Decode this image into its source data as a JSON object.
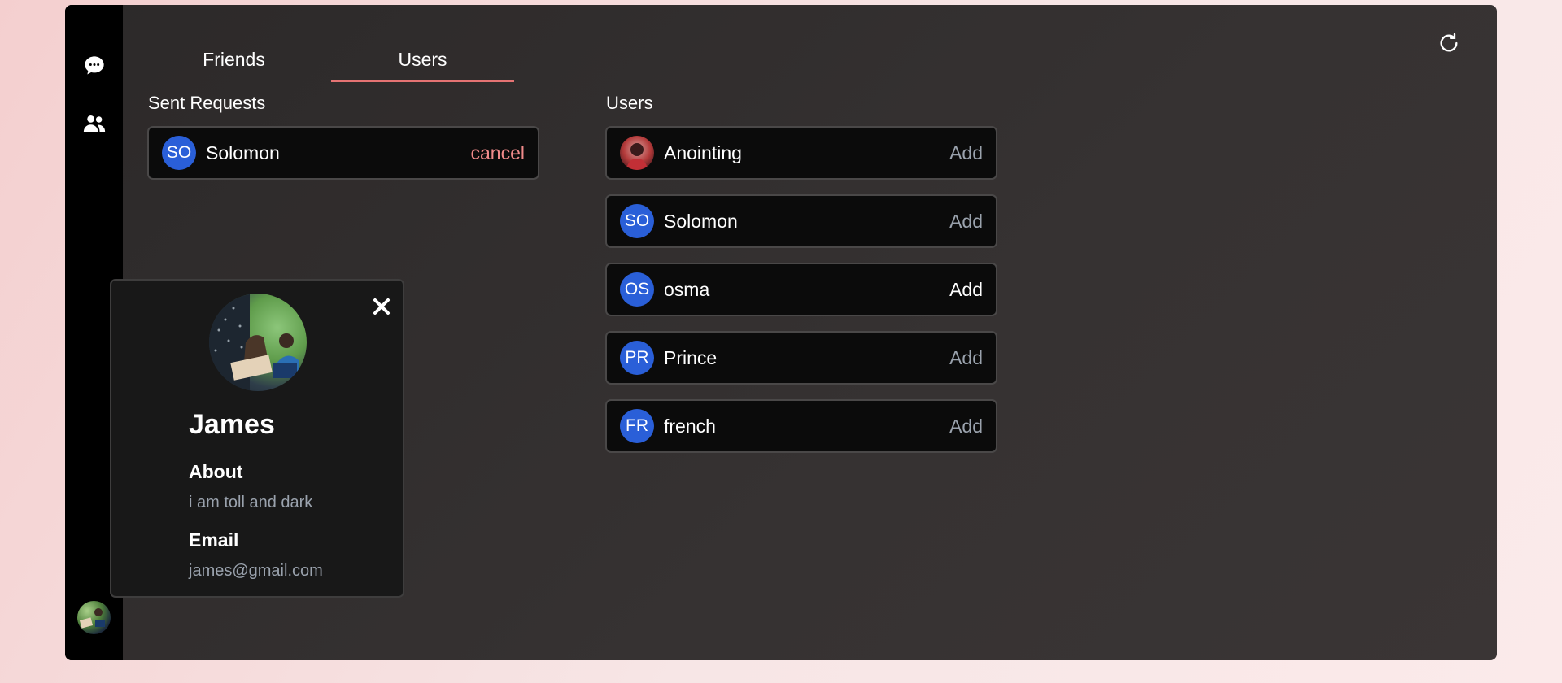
{
  "sidebar": {
    "icons": [
      "chat-bubble-icon",
      "people-icon"
    ],
    "avatar": "user-avatar"
  },
  "tabs": [
    {
      "label": "Friends",
      "active": false
    },
    {
      "label": "Users",
      "active": true
    }
  ],
  "toolbar": {
    "refresh_icon": "refresh-icon"
  },
  "sent_requests": {
    "title": "Sent Requests",
    "items": [
      {
        "initials": "SO",
        "name": "Solomon",
        "action": "cancel"
      }
    ]
  },
  "users": {
    "title": "Users",
    "items": [
      {
        "initials": "",
        "avatar": "photo",
        "name": "Anointing",
        "action": "Add"
      },
      {
        "initials": "SO",
        "name": "Solomon",
        "action": "Add"
      },
      {
        "initials": "OS",
        "name": "osma",
        "action": "Add"
      },
      {
        "initials": "PR",
        "name": "Prince",
        "action": "Add"
      },
      {
        "initials": "FR",
        "name": "french",
        "action": "Add"
      }
    ]
  },
  "profile": {
    "name": "James",
    "about_label": "About",
    "about": "i am toll and dark",
    "email_label": "Email",
    "email": "james@gmail.com",
    "close_icon": "close-icon"
  },
  "colors": {
    "accent": "#e57373",
    "avatar_blue": "#2a5fd8",
    "cancel": "#f08a8a",
    "muted": "#9aa2ad"
  }
}
